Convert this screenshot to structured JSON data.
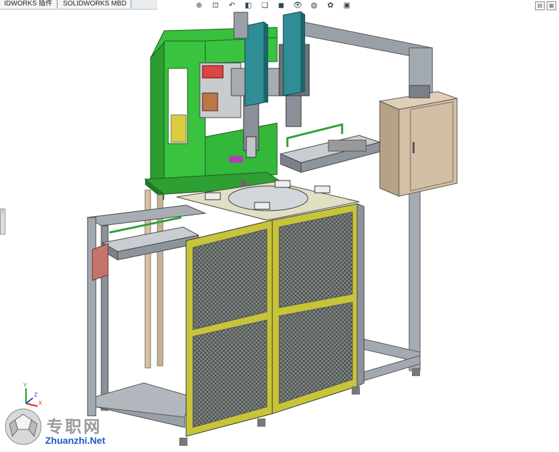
{
  "tabs": [
    {
      "label": "IDWORKS 插件"
    },
    {
      "label": "SOLIDWORKS MBD"
    }
  ],
  "toolbar": [
    {
      "icon": "zoom-to-fit-icon",
      "glyph": "⊕"
    },
    {
      "icon": "zoom-area-icon",
      "glyph": "⊡"
    },
    {
      "icon": "previous-view-icon",
      "glyph": "↶"
    },
    {
      "icon": "section-view-icon",
      "glyph": "◧"
    },
    {
      "icon": "view-orientation-icon",
      "glyph": "❑"
    },
    {
      "icon": "display-style-icon",
      "glyph": "◼"
    },
    {
      "icon": "hide-show-items-icon",
      "glyph": "👁"
    },
    {
      "icon": "edit-appearance-icon",
      "glyph": "◍"
    },
    {
      "icon": "apply-scene-icon",
      "glyph": "✿"
    },
    {
      "icon": "view-settings-icon",
      "glyph": "▣"
    }
  ],
  "window_controls": [
    "⊟",
    "⊠"
  ],
  "triad": {
    "x": "X",
    "y": "Y",
    "z": "Z"
  },
  "watermark": {
    "chinese": "专职网",
    "site": "Zhuanzhi.Net"
  },
  "colors": {
    "machine_green": "#2fae34",
    "frame_gray": "#9aa0a8",
    "guard_yellow": "#c8c43a",
    "actuator_teal": "#2e8d95",
    "control_box": "#d2bfa5",
    "watermark_blue": "#2156c8"
  }
}
